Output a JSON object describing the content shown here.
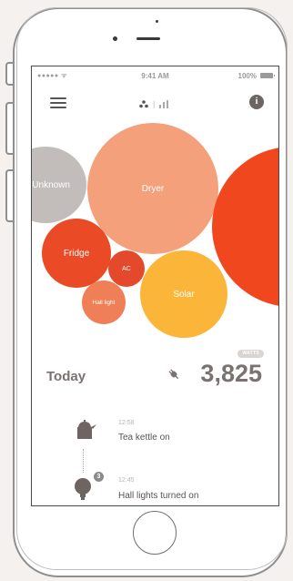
{
  "status_bar": {
    "signal": "●●●●● ᯤ",
    "time": "9:41 AM",
    "battery": "100%"
  },
  "header": {
    "menu_icon": "hamburger-menu-icon",
    "view_toggle_icons": [
      "bubbles-view-icon",
      "bar-chart-view-icon"
    ],
    "info_label": "i"
  },
  "colors": {
    "unknown": "#c2bcba",
    "dryer": "#f3a07b",
    "fridge": "#ea4b26",
    "ac": "#e3492a",
    "hall_light": "#ef7f57",
    "solar": "#fbb63a",
    "large_red": "#f0471f",
    "text_dark": "#7a7270"
  },
  "bubbles": {
    "unknown": "Unknown",
    "dryer": "Dryer",
    "fridge": "Fridge",
    "ac": "AC",
    "hall_light": "Hall light",
    "solar": "Solar"
  },
  "today": {
    "label": "Today",
    "badge": "WATTS",
    "value": "3,825"
  },
  "timeline": [
    {
      "time": "12:58",
      "text": "Tea kettle on",
      "icon": "tea-kettle-icon"
    },
    {
      "time": "12:45",
      "text": "Hall lights turned on",
      "icon": "light-bulb-icon",
      "count": "3"
    }
  ]
}
